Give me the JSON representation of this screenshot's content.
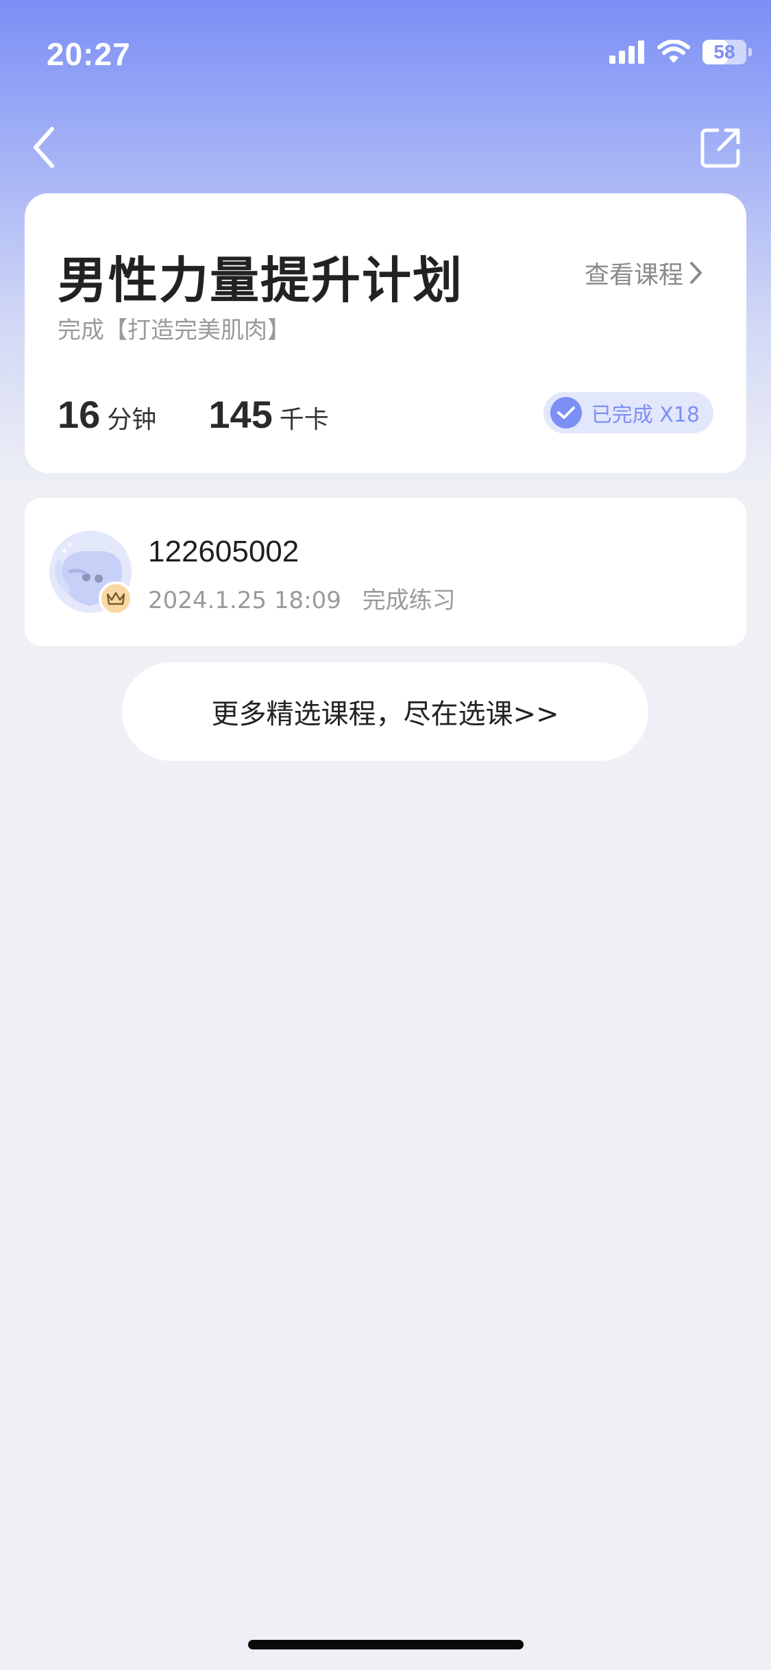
{
  "status_bar": {
    "time": "20:27",
    "battery": "58",
    "battery_level": 0.58
  },
  "course": {
    "title": "男性力量提升计划",
    "view_link": "查看课程",
    "subtitle": "完成【打造完美肌肉】",
    "duration_value": "16",
    "duration_unit": "分钟",
    "calories_value": "145",
    "calories_unit": "千卡",
    "completed_badge": "已完成 X18"
  },
  "record": {
    "user_id": "122605002",
    "time": "2024.1.25 18:09",
    "action": "完成练习"
  },
  "more_courses_label": "更多精选课程，尽在选课>>",
  "colors": {
    "accent": "#7b8ff5",
    "background": "#eff0f5",
    "card": "#ffffff",
    "crown": "#f8d9a4"
  },
  "icons": {
    "back": "chevron-left-icon",
    "share": "share-icon",
    "view_course": "chevron-right-icon",
    "completed": "check-icon",
    "crown": "crown-icon"
  }
}
